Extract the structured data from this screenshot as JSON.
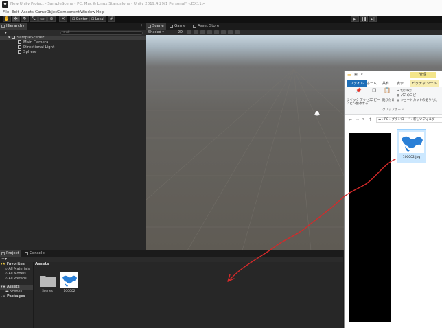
{
  "window": {
    "title": "New Unity Project - SampleScene - PC, Mac & Linux Standalone - Unity 2019.4.29f1 Personal* <DX11>"
  },
  "menu": [
    "File",
    "Edit",
    "Assets",
    "GameObject",
    "Component",
    "Window",
    "Help"
  ],
  "toolbar": {
    "pivot_label": "Center",
    "space_label": "Local"
  },
  "hierarchy": {
    "tab_label": "Hierarchy",
    "search_placeholder": "All",
    "scene_name": "SampleScene*",
    "objects": [
      "Main Camera",
      "Directional Light",
      "Sphere"
    ]
  },
  "scene": {
    "tabs": [
      "Scene",
      "Game",
      "Asset Store"
    ],
    "shading_mode": "Shaded",
    "mode_2d": "2D"
  },
  "project": {
    "tabs": [
      "Project",
      "Console"
    ],
    "favorites_label": "Favorites",
    "favorites": [
      "All Materials",
      "All Models",
      "All Prefabs"
    ],
    "assets_label": "Assets",
    "assets_children": [
      "Scenes"
    ],
    "packages_label": "Packages",
    "breadcrumb": "Assets",
    "items": [
      {
        "name": "Scenes",
        "kind": "folder"
      },
      {
        "name": "100002",
        "kind": "image"
      }
    ]
  },
  "explorer": {
    "context_tab_top": "管理",
    "ribbon_tabs": [
      "ファイル",
      "ホーム",
      "共有",
      "表示",
      "ピクチャ ツール"
    ],
    "ribbon_buttons": {
      "quick_access_line1": "クイック アクセス",
      "quick_access_line2": "にピン留めする",
      "copy": "コピー",
      "paste": "貼り付け",
      "cut": "切り取り",
      "copy_path": "パスのコピー",
      "paste_shortcut": "ショートカットの貼り付け",
      "group_clipboard": "クリップボード"
    },
    "breadcrumb": [
      "PC",
      "ダウンロード",
      "新しいフォルダー"
    ],
    "file_name": "100002.jpg"
  },
  "colors": {
    "unity_dark": "#282828",
    "selection": "#3d3d3d",
    "explorer_file_tab": "#1e6fb8",
    "context_tab": "#f3e58a",
    "arrow": "#d42a2a"
  }
}
